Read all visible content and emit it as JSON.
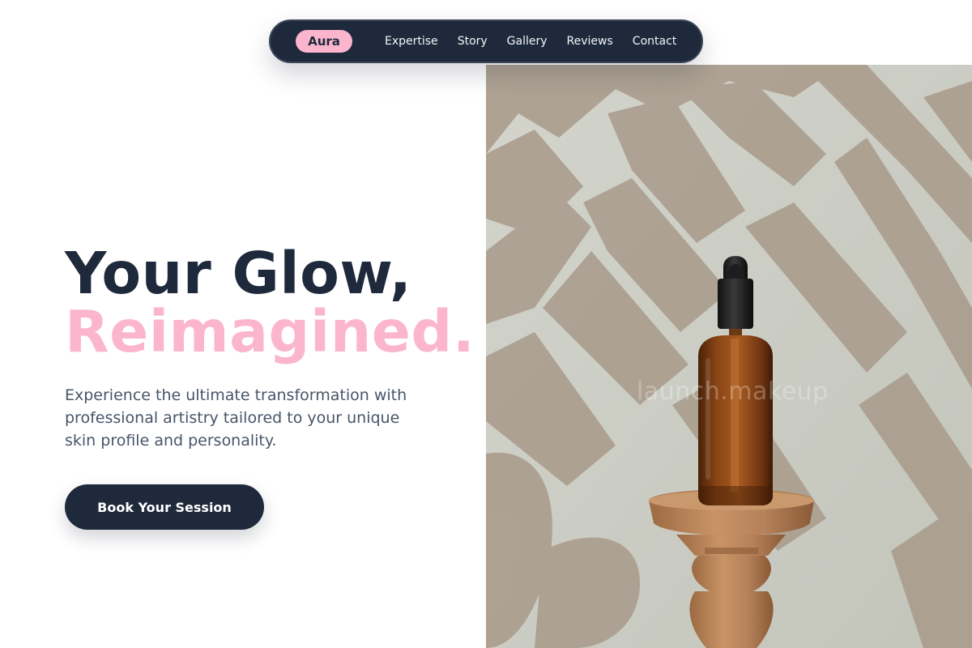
{
  "nav": {
    "brand": "Aura",
    "links": [
      "Expertise",
      "Story",
      "Gallery",
      "Reviews",
      "Contact"
    ]
  },
  "hero": {
    "title_line1": "Your Glow,",
    "title_line2": "Reimagined.",
    "description": "Experience the ultimate transformation with professional artistry tailored to your unique skin profile and personality.",
    "cta_label": "Book Your Session"
  },
  "photo": {
    "watermark": "launch.makeup",
    "icons": [
      "dropper-bottle-icon",
      "wooden-pedestal-icon",
      "palm-leaf-shadow-icon"
    ]
  },
  "colors": {
    "navy": "#1e293b",
    "pink": "#fbb6ce",
    "body_text": "#475569",
    "white": "#ffffff"
  }
}
